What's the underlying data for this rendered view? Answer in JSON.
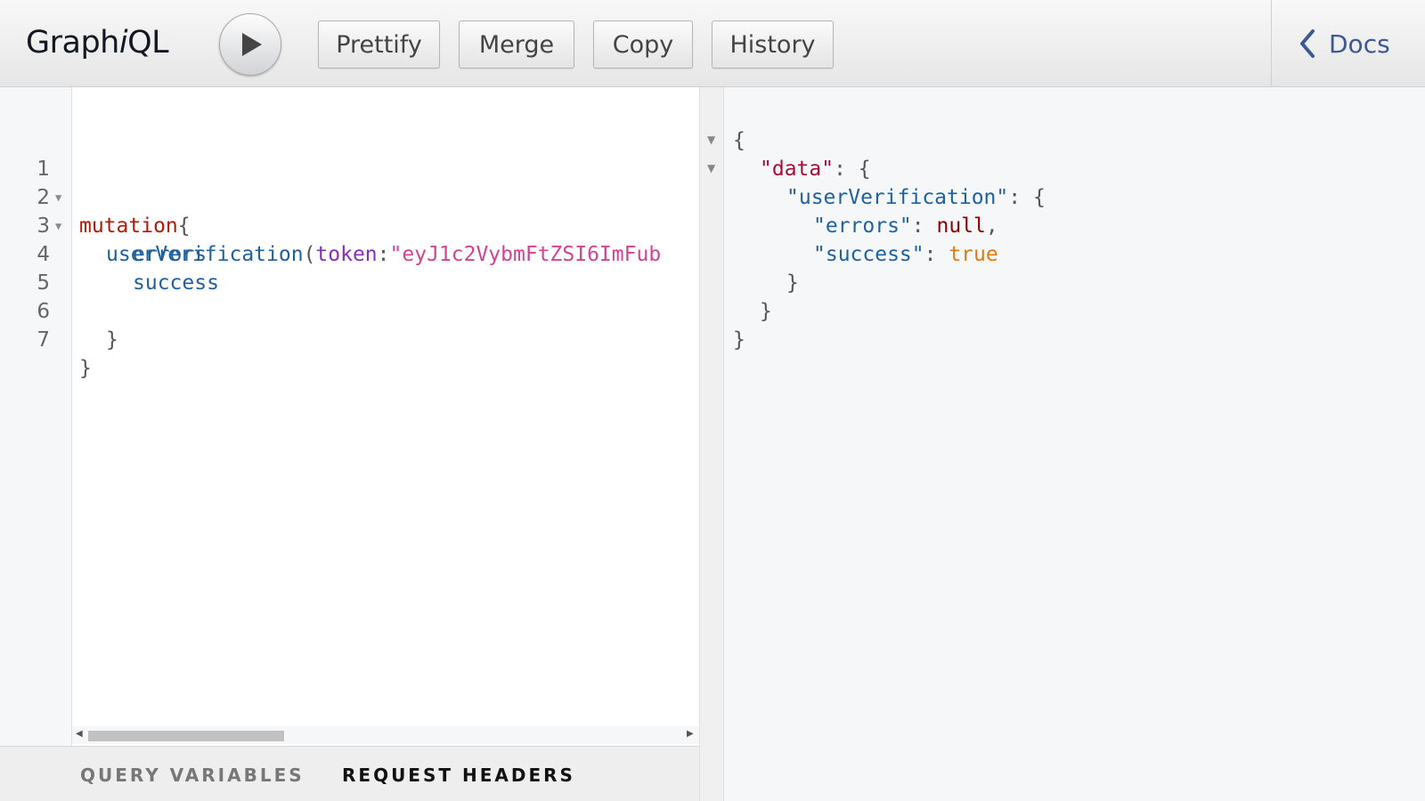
{
  "toolbar": {
    "title_pre": "Graph",
    "title_i": "i",
    "title_post": "QL",
    "run_icon": "play-icon",
    "buttons": {
      "prettify": "Prettify",
      "merge": "Merge",
      "copy": "Copy",
      "history": "History"
    },
    "docs_icon": "chevron-left-icon",
    "docs_label": "Docs"
  },
  "editor": {
    "line_numbers": [
      "1",
      "2",
      "3",
      "4",
      "5",
      "6",
      "7"
    ],
    "lines": {
      "l1_keyword": "mutation",
      "l1_brace": "{",
      "l2_indent": "  ",
      "l2_field": "userVerification",
      "l2_paren": "(",
      "l2_arg": "token",
      "l2_colon": ":",
      "l2_string": "\"eyJ1c2VybmFtZSI6ImFub",
      "l3_field": "errors",
      "l4_field": "success",
      "l6_brace": "}",
      "l7_brace": "}"
    }
  },
  "bottom_tabs": {
    "query_variables": "QUERY VARIABLES",
    "request_headers": "REQUEST HEADERS"
  },
  "result": {
    "open": "{",
    "data_key": "\"data\"",
    "uv_key": "\"userVerification\"",
    "errors_key": "\"errors\"",
    "errors_val": "null",
    "success_key": "\"success\"",
    "success_val": "true",
    "colon_brace": ": {",
    "colon": ": ",
    "comma": ",",
    "close": "}"
  },
  "colors": {
    "keyword": "#b11a04",
    "field": "#1f61a0",
    "argument": "#8b2bb9",
    "string": "#d64292",
    "docs_link": "#3b5998"
  }
}
